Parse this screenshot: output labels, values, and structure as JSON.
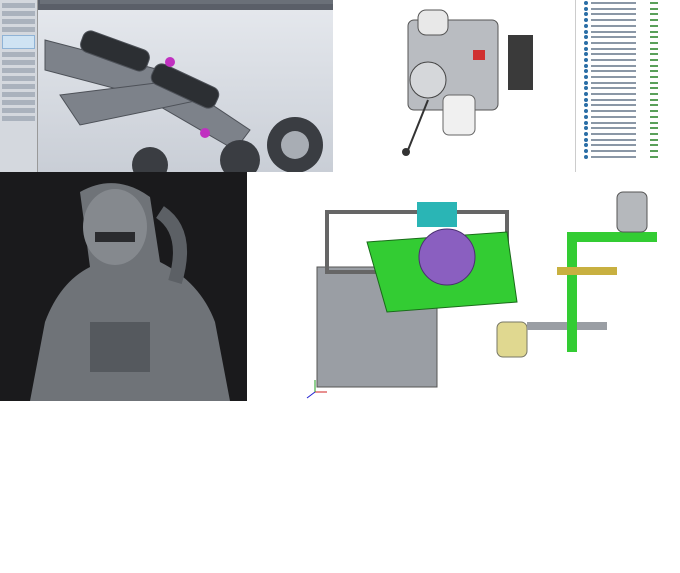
{
  "panels": {
    "top_left": {
      "content": "cad-assembly-suspension"
    },
    "top_right": {
      "content": "cad-assembly-gearbox-with-feature-tree"
    },
    "bottom_left": {
      "content": "sculpted-armor-bust"
    },
    "bottom_right": {
      "content": "cad-machine-assembly"
    }
  },
  "colors": {
    "green_part": "#33cc33",
    "cyan_part": "#2ab5b5",
    "purple_part": "#8a5fc0",
    "yellow_part": "#e0d890",
    "grey_part": "#9a9ea4"
  },
  "tree_rows": 28
}
